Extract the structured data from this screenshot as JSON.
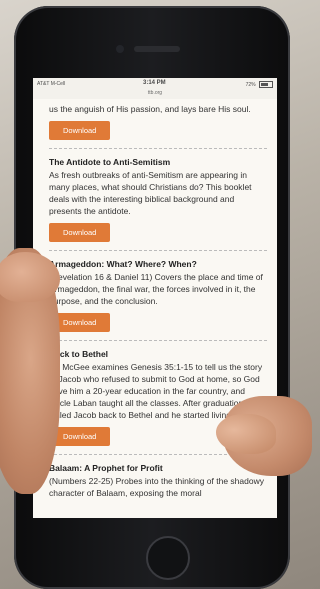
{
  "status": {
    "carrier": "AT&T M-Cell",
    "time": "3:14 PM",
    "battery": "72%",
    "url": "ttb.org"
  },
  "partial_item": {
    "desc": "us the anguish of His passion, and lays bare His soul.",
    "button": "Download"
  },
  "items": [
    {
      "title": "The Antidote to Anti-Semitism",
      "desc": "As fresh outbreaks of anti-Semitism are appearing in many places, what should Christians do? This booklet deals with the interesting biblical background and presents the antidote.",
      "button": "Download"
    },
    {
      "title": "Armageddon: What? Where? When?",
      "desc": "(Revelation 16 & Daniel 11) Covers the place and time of Armageddon, the final war, the forces involved in it, the purpose, and the conclusion.",
      "button": "Download"
    },
    {
      "title": "Back to Bethel",
      "desc": "Dr. McGee examines Genesis 35:1-15 to tell us the story of Jacob who refused to submit to God at home, so God gave him a 20-year education in the far country, and Uncle Laban taught all the classes. After graduation, God called Jacob back to Bethel and he started living for God.",
      "button": "Download"
    },
    {
      "title": "Balaam: A Prophet for Profit",
      "desc": "(Numbers 22-25) Probes into the thinking of the shadowy character of Balaam, exposing the moral",
      "button": ""
    }
  ]
}
